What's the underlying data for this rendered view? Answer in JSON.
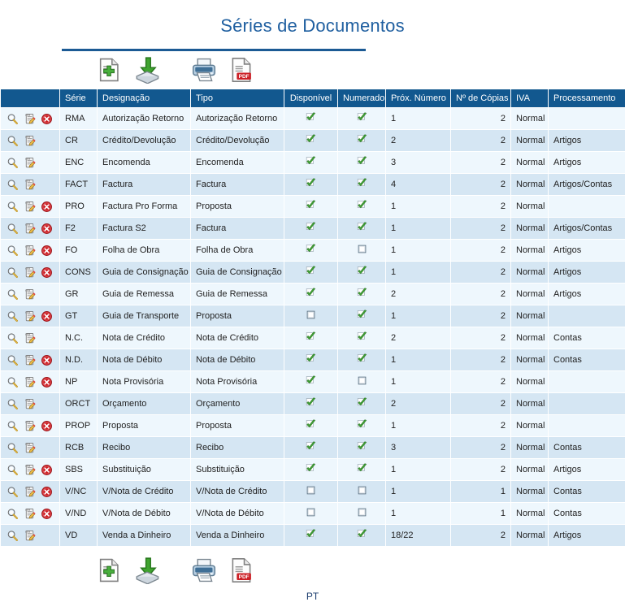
{
  "page": {
    "title": "Séries de Documentos",
    "footer_language": "PT"
  },
  "toolbar": {
    "buttons": [
      {
        "name": "new-document-button",
        "icon": "new-document-icon",
        "label": "Novo"
      },
      {
        "name": "import-button",
        "icon": "import-icon",
        "label": "Importar"
      },
      {
        "name": "print-button",
        "icon": "printer-icon",
        "label": "Imprimir"
      },
      {
        "name": "export-pdf-button",
        "icon": "pdf-icon",
        "label": "Exportar PDF"
      }
    ]
  },
  "row_actions": {
    "view": {
      "icon": "magnifier-icon",
      "label": "Ver"
    },
    "edit": {
      "icon": "edit-notepad-icon",
      "label": "Editar"
    },
    "delete": {
      "icon": "delete-circle-icon",
      "label": "Eliminar"
    }
  },
  "colors": {
    "header_bg": "#12588f",
    "title": "#1f5fa0",
    "rule": "#1b5a94",
    "row_odd": "#eef7fd",
    "row_even": "#d5e6f3",
    "check_green": "#3f9c35",
    "delete_red": "#cc2026"
  },
  "table": {
    "columns": [
      {
        "key": "actions",
        "label": "",
        "align": "left"
      },
      {
        "key": "serie",
        "label": "Série",
        "align": "left"
      },
      {
        "key": "designacao",
        "label": "Designação",
        "align": "left"
      },
      {
        "key": "tipo",
        "label": "Tipo",
        "align": "left"
      },
      {
        "key": "disponivel",
        "label": "Disponível",
        "align": "center"
      },
      {
        "key": "numerado",
        "label": "Numerado",
        "align": "center"
      },
      {
        "key": "prox_numero",
        "label": "Próx. Número",
        "align": "left"
      },
      {
        "key": "n_copias",
        "label": "Nº de Cópias",
        "align": "right"
      },
      {
        "key": "iva",
        "label": "IVA",
        "align": "left"
      },
      {
        "key": "processamento",
        "label": "Processamento",
        "align": "left"
      }
    ],
    "rows": [
      {
        "serie": "RMA",
        "designacao": "Autorização Retorno",
        "tipo": "Autorização Retorno",
        "disponivel": true,
        "numerado": true,
        "prox_numero": "1",
        "n_copias": "2",
        "iva": "Normal",
        "processamento": "",
        "deletable": true
      },
      {
        "serie": "CR",
        "designacao": "Crédito/Devolução",
        "tipo": "Crédito/Devolução",
        "disponivel": true,
        "numerado": true,
        "prox_numero": "2",
        "n_copias": "2",
        "iva": "Normal",
        "processamento": "Artigos",
        "deletable": false
      },
      {
        "serie": "ENC",
        "designacao": "Encomenda",
        "tipo": "Encomenda",
        "disponivel": true,
        "numerado": true,
        "prox_numero": "3",
        "n_copias": "2",
        "iva": "Normal",
        "processamento": "Artigos",
        "deletable": false
      },
      {
        "serie": "FACT",
        "designacao": "Factura",
        "tipo": "Factura",
        "disponivel": true,
        "numerado": true,
        "prox_numero": "4",
        "n_copias": "2",
        "iva": "Normal",
        "processamento": "Artigos/Contas",
        "deletable": false
      },
      {
        "serie": "PRO",
        "designacao": "Factura Pro Forma",
        "tipo": "Proposta",
        "disponivel": true,
        "numerado": true,
        "prox_numero": "1",
        "n_copias": "2",
        "iva": "Normal",
        "processamento": "",
        "deletable": true
      },
      {
        "serie": "F2",
        "designacao": "Factura S2",
        "tipo": "Factura",
        "disponivel": true,
        "numerado": true,
        "prox_numero": "1",
        "n_copias": "2",
        "iva": "Normal",
        "processamento": "Artigos/Contas",
        "deletable": true
      },
      {
        "serie": "FO",
        "designacao": "Folha de Obra",
        "tipo": "Folha de Obra",
        "disponivel": true,
        "numerado": false,
        "prox_numero": "1",
        "n_copias": "2",
        "iva": "Normal",
        "processamento": "Artigos",
        "deletable": true
      },
      {
        "serie": "CONS",
        "designacao": "Guia de Consignação",
        "tipo": "Guia de Consignação",
        "disponivel": true,
        "numerado": true,
        "prox_numero": "1",
        "n_copias": "2",
        "iva": "Normal",
        "processamento": "Artigos",
        "deletable": true
      },
      {
        "serie": "GR",
        "designacao": "Guia de Remessa",
        "tipo": "Guia de Remessa",
        "disponivel": true,
        "numerado": true,
        "prox_numero": "2",
        "n_copias": "2",
        "iva": "Normal",
        "processamento": "Artigos",
        "deletable": false
      },
      {
        "serie": "GT",
        "designacao": "Guia de Transporte",
        "tipo": "Proposta",
        "disponivel": false,
        "numerado": true,
        "prox_numero": "1",
        "n_copias": "2",
        "iva": "Normal",
        "processamento": "",
        "deletable": true
      },
      {
        "serie": "N.C.",
        "designacao": "Nota de Crédito",
        "tipo": "Nota de Crédito",
        "disponivel": true,
        "numerado": true,
        "prox_numero": "2",
        "n_copias": "2",
        "iva": "Normal",
        "processamento": "Contas",
        "deletable": false
      },
      {
        "serie": "N.D.",
        "designacao": "Nota de Débito",
        "tipo": "Nota de Débito",
        "disponivel": true,
        "numerado": true,
        "prox_numero": "1",
        "n_copias": "2",
        "iva": "Normal",
        "processamento": "Contas",
        "deletable": true
      },
      {
        "serie": "NP",
        "designacao": "Nota Provisória",
        "tipo": "Nota Provisória",
        "disponivel": true,
        "numerado": false,
        "prox_numero": "1",
        "n_copias": "2",
        "iva": "Normal",
        "processamento": "",
        "deletable": true
      },
      {
        "serie": "ORCT",
        "designacao": "Orçamento",
        "tipo": "Orçamento",
        "disponivel": true,
        "numerado": true,
        "prox_numero": "2",
        "n_copias": "2",
        "iva": "Normal",
        "processamento": "",
        "deletable": false
      },
      {
        "serie": "PROP",
        "designacao": "Proposta",
        "tipo": "Proposta",
        "disponivel": true,
        "numerado": true,
        "prox_numero": "1",
        "n_copias": "2",
        "iva": "Normal",
        "processamento": "",
        "deletable": true
      },
      {
        "serie": "RCB",
        "designacao": "Recibo",
        "tipo": "Recibo",
        "disponivel": true,
        "numerado": true,
        "prox_numero": "3",
        "n_copias": "2",
        "iva": "Normal",
        "processamento": "Contas",
        "deletable": false
      },
      {
        "serie": "SBS",
        "designacao": "Substituição",
        "tipo": "Substituição",
        "disponivel": true,
        "numerado": true,
        "prox_numero": "1",
        "n_copias": "2",
        "iva": "Normal",
        "processamento": "Artigos",
        "deletable": true
      },
      {
        "serie": "V/NC",
        "designacao": "V/Nota de Crédito",
        "tipo": "V/Nota de Crédito",
        "disponivel": false,
        "numerado": false,
        "prox_numero": "1",
        "n_copias": "1",
        "iva": "Normal",
        "processamento": "Contas",
        "deletable": true
      },
      {
        "serie": "V/ND",
        "designacao": "V/Nota de Débito",
        "tipo": "V/Nota de Débito",
        "disponivel": false,
        "numerado": false,
        "prox_numero": "1",
        "n_copias": "1",
        "iva": "Normal",
        "processamento": "Contas",
        "deletable": true
      },
      {
        "serie": "VD",
        "designacao": "Venda a Dinheiro",
        "tipo": "Venda a Dinheiro",
        "disponivel": true,
        "numerado": true,
        "prox_numero": "18/22",
        "n_copias": "2",
        "iva": "Normal",
        "processamento": "Artigos",
        "deletable": false
      }
    ]
  }
}
